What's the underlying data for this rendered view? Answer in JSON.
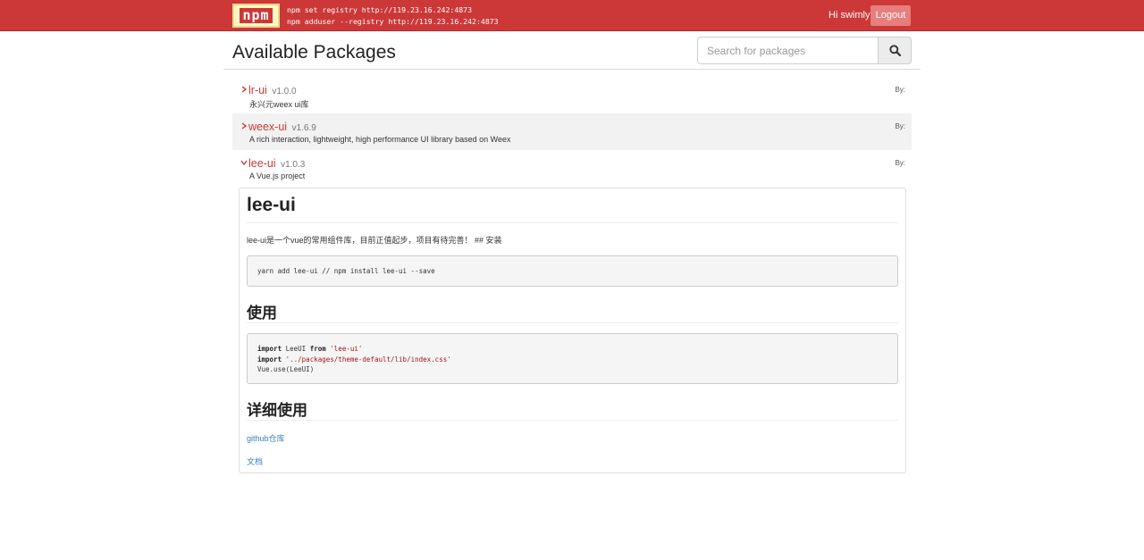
{
  "header": {
    "logo_text": "npm",
    "cmd_line_1": "npm set registry http://119.23.16.242:4873",
    "cmd_line_2": "npm adduser --registry http://119.23.16.242:4873",
    "greeting": "Hi swimly",
    "logout_label": "Logout"
  },
  "page": {
    "title": "Available Packages",
    "search_placeholder": "Search for packages"
  },
  "packages": [
    {
      "name": "lr-ui",
      "version": "v1.0.0",
      "description": "永兴元weex ui库",
      "by": "By:",
      "expanded": false
    },
    {
      "name": "weex-ui",
      "version": "v1.6.9",
      "description": "A rich interaction, lightweight, high performance UI library based on Weex",
      "by": "By:",
      "expanded": false
    },
    {
      "name": "lee-ui",
      "version": "v1.0.3",
      "description": "A Vue.js project",
      "by": "By:",
      "expanded": true
    }
  ],
  "readme": {
    "title": "lee-ui",
    "intro": "lee-ui是一个vue的常用组件库，目前正值起步，项目有待完善！ ## 安装",
    "install_code": "yarn add lee-ui // npm install lee-ui --save",
    "usage_heading": "使用",
    "usage_code": {
      "kw_import": "import",
      "kw_from": "from",
      "name": "LeeUI",
      "module_str": "'lee-ui'",
      "css_str": "'../packages/theme-default/lib/index.css'",
      "line3": "Vue.use(LeeUI)"
    },
    "detail_heading": "详细使用",
    "github_link": "github仓库",
    "docs_link": "文档"
  },
  "colors": {
    "brand": "#cb3837",
    "link": "#3c7ec0"
  }
}
